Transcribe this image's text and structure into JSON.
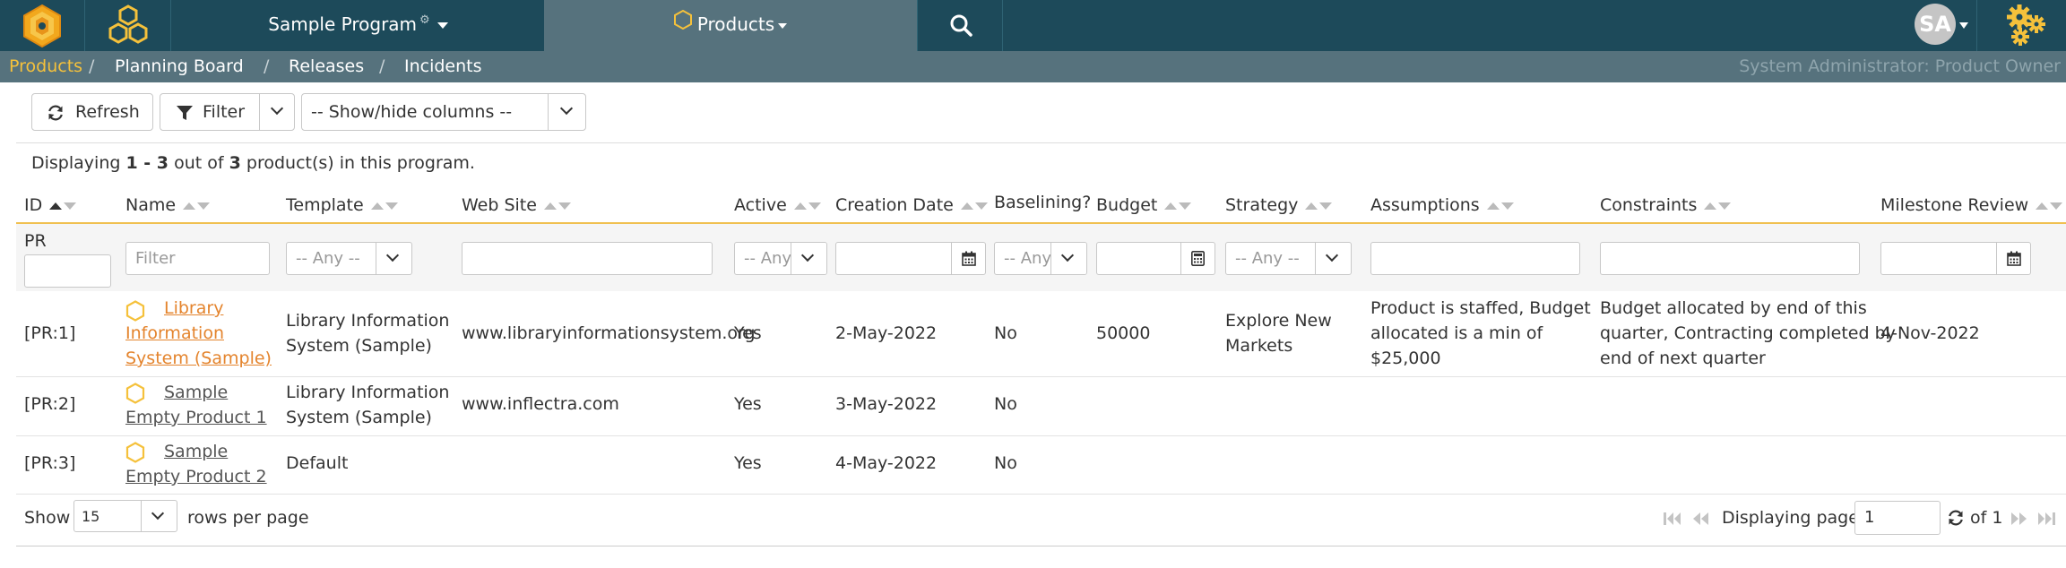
{
  "topbar": {
    "program": "Sample Program",
    "products_menu": "Products",
    "avatar_initials": "SA",
    "icons": [
      "spira-logo-icon",
      "honeycomb-icon",
      "gear-icon",
      "hexagon-icon",
      "search-icon",
      "admin-gears-icon"
    ]
  },
  "breadcrumb": {
    "items": [
      "Products",
      "Planning Board",
      "Releases",
      "Incidents"
    ],
    "separator": "/",
    "role": "System Administrator: Product Owner"
  },
  "toolbar": {
    "refresh": "Refresh",
    "filter": "Filter",
    "columns": "-- Show/hide columns --"
  },
  "summary": {
    "prefix": "Displaying",
    "range": "1 - 3",
    "middle": "out of",
    "total": "3",
    "suffix": "product(s) in this program."
  },
  "columns": [
    "ID",
    "Name",
    "Template",
    "Web Site",
    "Active",
    "Creation Date",
    "Baselining?",
    "Budget",
    "Strategy",
    "Assumptions",
    "Constraints",
    "Milestone Review"
  ],
  "filters": {
    "id_prefix": "PR",
    "name_placeholder": "Filter",
    "any": "-- Any --",
    "any_short": "-- Any"
  },
  "rows": [
    {
      "id": "[PR:1]",
      "name": [
        "Library",
        "Information",
        "System (Sample)"
      ],
      "template": [
        "Library Information",
        "System (Sample)"
      ],
      "website": "www.libraryinformationsystem.org",
      "active": "Yes",
      "created": "2-May-2022",
      "baselining": "No",
      "budget": "50000",
      "strategy": [
        "Explore New",
        "Markets"
      ],
      "assumptions": [
        "Product is staffed, Budget",
        "allocated is a min of",
        "$25,000"
      ],
      "constraints": [
        "Budget allocated by end of this",
        "quarter, Contracting completed by",
        "end of next quarter"
      ],
      "milestone": "4-Nov-2022"
    },
    {
      "id": "[PR:2]",
      "name": [
        "Sample",
        "Empty Product 1"
      ],
      "template": [
        "Library Information",
        "System (Sample)"
      ],
      "website": "www.inflectra.com",
      "active": "Yes",
      "created": "3-May-2022",
      "baselining": "No"
    },
    {
      "id": "[PR:3]",
      "name": [
        "Sample",
        "Empty Product 2"
      ],
      "template": [
        "Default"
      ],
      "active": "Yes",
      "created": "4-May-2022",
      "baselining": "No"
    }
  ],
  "pager": {
    "show": "Show",
    "page_size": "15",
    "rows_per_page": "rows per page",
    "displaying_page": "Displaying page",
    "page": "1",
    "of": "of 1"
  },
  "colors": {
    "nav_dark": "#1d4a5a",
    "nav_light": "#56727d",
    "accent_yellow": "#f5c13b",
    "link_orange": "#e4842d"
  }
}
